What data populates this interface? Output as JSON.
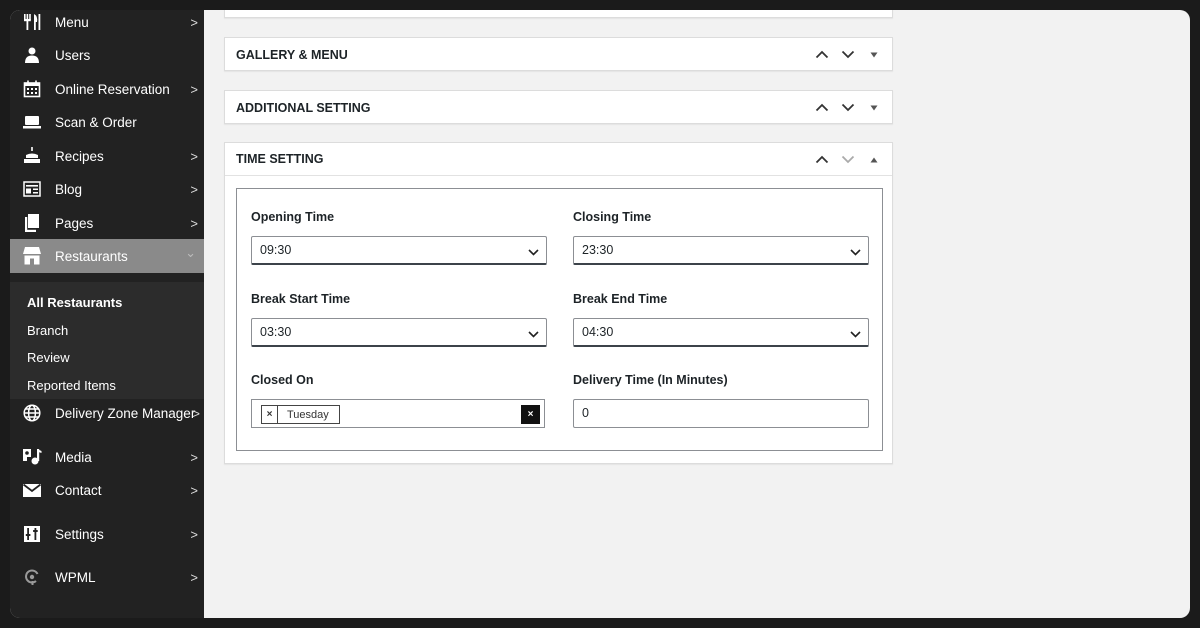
{
  "sidebar": {
    "items": [
      {
        "label": "Menu",
        "icon": "utensils-icon",
        "has_arrow": true,
        "arrow": ">"
      },
      {
        "label": "Users",
        "icon": "user-icon",
        "has_arrow": false
      },
      {
        "label": "Online Reservation",
        "icon": "calendar-icon",
        "has_arrow": true,
        "arrow": ">"
      },
      {
        "label": "Scan & Order",
        "icon": "scan-icon",
        "has_arrow": false
      },
      {
        "label": "Recipes",
        "icon": "cake-icon",
        "has_arrow": true,
        "arrow": ">"
      },
      {
        "label": "Blog",
        "icon": "blog-icon",
        "has_arrow": true,
        "arrow": ">"
      },
      {
        "label": "Pages",
        "icon": "pages-icon",
        "has_arrow": true,
        "arrow": ">"
      },
      {
        "label": "Restaurants",
        "icon": "store-icon",
        "has_arrow": true,
        "arrow": "⌄",
        "active": true
      },
      {
        "label": "Delivery Zone Manager",
        "icon": "globe-icon",
        "has_arrow": true,
        "arrow": ">"
      },
      {
        "label": "Media",
        "icon": "media-icon",
        "has_arrow": true,
        "arrow": ">"
      },
      {
        "label": "Contact",
        "icon": "envelope-icon",
        "has_arrow": true,
        "arrow": ">"
      },
      {
        "label": "Settings",
        "icon": "settings-icon",
        "has_arrow": true,
        "arrow": ">"
      },
      {
        "label": "WPML",
        "icon": "wpml-icon",
        "has_arrow": true,
        "arrow": ">"
      }
    ],
    "submenu": [
      "All Restaurants",
      "Branch",
      "Review",
      "Reported Items"
    ],
    "submenu_current": "All Restaurants"
  },
  "panels": {
    "gallery": {
      "title": "GALLERY & MENU",
      "collapsed": true
    },
    "additional": {
      "title": "ADDITIONAL SETTING",
      "collapsed": true
    },
    "time": {
      "title": "TIME SETTING",
      "collapsed": false
    }
  },
  "form": {
    "opening": {
      "label": "Opening Time",
      "value": "09:30"
    },
    "closing": {
      "label": "Closing Time",
      "value": "23:30"
    },
    "break_start": {
      "label": "Break Start Time",
      "value": "03:30"
    },
    "break_end": {
      "label": "Break End Time",
      "value": "04:30"
    },
    "closed_on": {
      "label": "Closed On",
      "tags": [
        "Tuesday"
      ],
      "remove_symbol": "×",
      "clear_symbol": "×"
    },
    "delivery": {
      "label": "Delivery Time (In Minutes)",
      "value": "0"
    }
  },
  "colors": {
    "sidebar_bg": "#222222",
    "active_item_bg": "#8a8a8a",
    "submenu_bg": "#2c2c2c",
    "page_bg": "#f2f2f2"
  }
}
